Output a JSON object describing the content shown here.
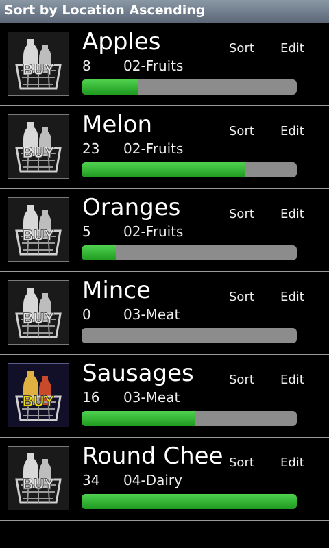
{
  "title": "Sort by Location Ascending",
  "items": [
    {
      "name": "Apples",
      "count": "8",
      "location": "02-Fruits",
      "sort_label": "Sort",
      "edit_label": "Edit",
      "progress": 0.26,
      "icon": "buy-basket-icon",
      "active": false
    },
    {
      "name": "Melon",
      "count": "23",
      "location": "02-Fruits",
      "sort_label": "Sort",
      "edit_label": "Edit",
      "progress": 0.76,
      "icon": "buy-basket-icon",
      "active": false
    },
    {
      "name": "Oranges",
      "count": "5",
      "location": "02-Fruits",
      "sort_label": "Sort",
      "edit_label": "Edit",
      "progress": 0.16,
      "icon": "buy-basket-icon",
      "active": false
    },
    {
      "name": "Mince",
      "count": "0",
      "location": "03-Meat",
      "sort_label": "Sort",
      "edit_label": "Edit",
      "progress": 0.0,
      "icon": "buy-basket-icon",
      "active": false
    },
    {
      "name": "Sausages",
      "count": "16",
      "location": "03-Meat",
      "sort_label": "Sort",
      "edit_label": "Edit",
      "progress": 0.53,
      "icon": "buy-basket-color-icon",
      "active": true
    },
    {
      "name": "Round Chee",
      "count": "34",
      "location": "04-Dairy",
      "sort_label": "Sort",
      "edit_label": "Edit",
      "progress": 1.0,
      "icon": "buy-basket-icon",
      "active": false
    }
  ],
  "thumb_text": "BUY",
  "colors": {
    "progress": "#2fb52f",
    "track": "#8c8c8c",
    "title_bar": "#6d7a89",
    "active_buy": "#f2e400"
  }
}
